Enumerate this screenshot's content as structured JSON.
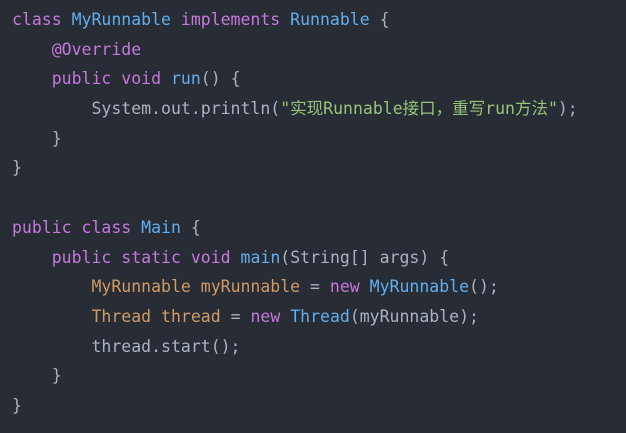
{
  "colors": {
    "background": "#282c34",
    "keyword": "#c678dd",
    "class_name": "#61afef",
    "method": "#61afef",
    "annotation": "#c678dd",
    "string": "#98c379",
    "type": "#d19a66",
    "plain": "#abb2bf"
  },
  "code_lines": [
    {
      "indent": "",
      "tokens": [
        {
          "t": "class",
          "k": "kw"
        },
        {
          "t": " ",
          "k": "plain"
        },
        {
          "t": "MyRunnable",
          "k": "cls"
        },
        {
          "t": " ",
          "k": "plain"
        },
        {
          "t": "implements",
          "k": "kw"
        },
        {
          "t": " ",
          "k": "plain"
        },
        {
          "t": "Runnable",
          "k": "cls"
        },
        {
          "t": " {",
          "k": "plain"
        }
      ]
    },
    {
      "indent": "    ",
      "tokens": [
        {
          "t": "@Override",
          "k": "ann"
        }
      ]
    },
    {
      "indent": "    ",
      "tokens": [
        {
          "t": "public",
          "k": "kw"
        },
        {
          "t": " ",
          "k": "plain"
        },
        {
          "t": "void",
          "k": "kw"
        },
        {
          "t": " ",
          "k": "plain"
        },
        {
          "t": "run",
          "k": "fn"
        },
        {
          "t": "() {",
          "k": "plain"
        }
      ]
    },
    {
      "indent": "        ",
      "tokens": [
        {
          "t": "System.out.println(",
          "k": "plain"
        },
        {
          "t": "\"实现Runnable接口，重写run方法\"",
          "k": "str"
        },
        {
          "t": ");",
          "k": "plain"
        }
      ]
    },
    {
      "indent": "    ",
      "tokens": [
        {
          "t": "}",
          "k": "plain"
        }
      ]
    },
    {
      "indent": "",
      "tokens": [
        {
          "t": "}",
          "k": "plain"
        }
      ]
    },
    {
      "indent": "",
      "tokens": []
    },
    {
      "indent": "",
      "tokens": [
        {
          "t": "public",
          "k": "kw"
        },
        {
          "t": " ",
          "k": "plain"
        },
        {
          "t": "class",
          "k": "kw"
        },
        {
          "t": " ",
          "k": "plain"
        },
        {
          "t": "Main",
          "k": "cls"
        },
        {
          "t": " {",
          "k": "plain"
        }
      ]
    },
    {
      "indent": "    ",
      "tokens": [
        {
          "t": "public",
          "k": "kw"
        },
        {
          "t": " ",
          "k": "plain"
        },
        {
          "t": "static",
          "k": "kw"
        },
        {
          "t": " ",
          "k": "plain"
        },
        {
          "t": "void",
          "k": "kw"
        },
        {
          "t": " ",
          "k": "plain"
        },
        {
          "t": "main",
          "k": "fn"
        },
        {
          "t": "(String[] args) {",
          "k": "plain"
        }
      ]
    },
    {
      "indent": "        ",
      "tokens": [
        {
          "t": "MyRunnable",
          "k": "type"
        },
        {
          "t": " ",
          "k": "plain"
        },
        {
          "t": "myRunnable",
          "k": "type"
        },
        {
          "t": " = ",
          "k": "plain"
        },
        {
          "t": "new",
          "k": "kw"
        },
        {
          "t": " ",
          "k": "plain"
        },
        {
          "t": "MyRunnable",
          "k": "cls"
        },
        {
          "t": "();",
          "k": "plain"
        }
      ]
    },
    {
      "indent": "        ",
      "tokens": [
        {
          "t": "Thread",
          "k": "type"
        },
        {
          "t": " ",
          "k": "plain"
        },
        {
          "t": "thread",
          "k": "type"
        },
        {
          "t": " = ",
          "k": "plain"
        },
        {
          "t": "new",
          "k": "kw"
        },
        {
          "t": " ",
          "k": "plain"
        },
        {
          "t": "Thread",
          "k": "cls"
        },
        {
          "t": "(myRunnable);",
          "k": "plain"
        }
      ]
    },
    {
      "indent": "        ",
      "tokens": [
        {
          "t": "thread.start();",
          "k": "plain"
        }
      ]
    },
    {
      "indent": "    ",
      "tokens": [
        {
          "t": "}",
          "k": "plain"
        }
      ]
    },
    {
      "indent": "",
      "tokens": [
        {
          "t": "}",
          "k": "plain"
        }
      ]
    }
  ]
}
